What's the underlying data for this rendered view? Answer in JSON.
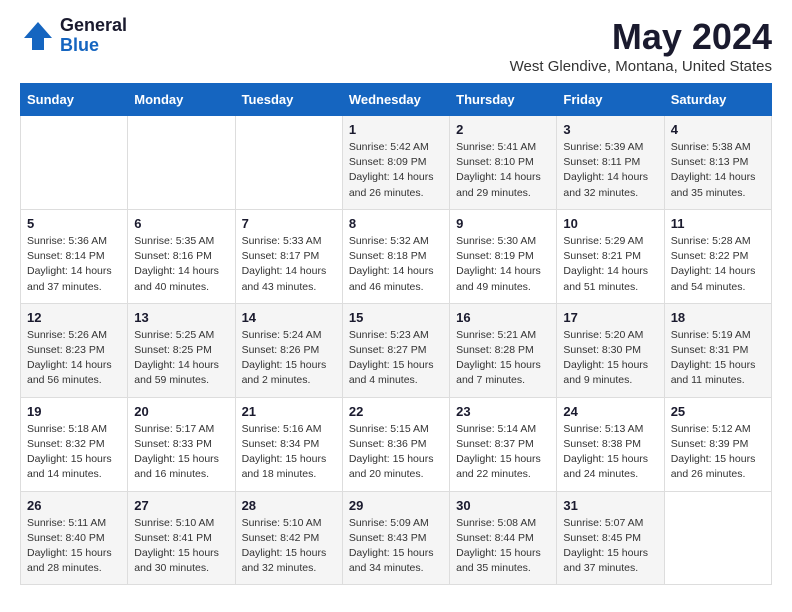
{
  "header": {
    "logo_general": "General",
    "logo_blue": "Blue",
    "title": "May 2024",
    "subtitle": "West Glendive, Montana, United States"
  },
  "weekdays": [
    "Sunday",
    "Monday",
    "Tuesday",
    "Wednesday",
    "Thursday",
    "Friday",
    "Saturday"
  ],
  "weeks": [
    [
      {
        "day": "",
        "info": ""
      },
      {
        "day": "",
        "info": ""
      },
      {
        "day": "",
        "info": ""
      },
      {
        "day": "1",
        "info": "Sunrise: 5:42 AM\nSunset: 8:09 PM\nDaylight: 14 hours\nand 26 minutes."
      },
      {
        "day": "2",
        "info": "Sunrise: 5:41 AM\nSunset: 8:10 PM\nDaylight: 14 hours\nand 29 minutes."
      },
      {
        "day": "3",
        "info": "Sunrise: 5:39 AM\nSunset: 8:11 PM\nDaylight: 14 hours\nand 32 minutes."
      },
      {
        "day": "4",
        "info": "Sunrise: 5:38 AM\nSunset: 8:13 PM\nDaylight: 14 hours\nand 35 minutes."
      }
    ],
    [
      {
        "day": "5",
        "info": "Sunrise: 5:36 AM\nSunset: 8:14 PM\nDaylight: 14 hours\nand 37 minutes."
      },
      {
        "day": "6",
        "info": "Sunrise: 5:35 AM\nSunset: 8:16 PM\nDaylight: 14 hours\nand 40 minutes."
      },
      {
        "day": "7",
        "info": "Sunrise: 5:33 AM\nSunset: 8:17 PM\nDaylight: 14 hours\nand 43 minutes."
      },
      {
        "day": "8",
        "info": "Sunrise: 5:32 AM\nSunset: 8:18 PM\nDaylight: 14 hours\nand 46 minutes."
      },
      {
        "day": "9",
        "info": "Sunrise: 5:30 AM\nSunset: 8:19 PM\nDaylight: 14 hours\nand 49 minutes."
      },
      {
        "day": "10",
        "info": "Sunrise: 5:29 AM\nSunset: 8:21 PM\nDaylight: 14 hours\nand 51 minutes."
      },
      {
        "day": "11",
        "info": "Sunrise: 5:28 AM\nSunset: 8:22 PM\nDaylight: 14 hours\nand 54 minutes."
      }
    ],
    [
      {
        "day": "12",
        "info": "Sunrise: 5:26 AM\nSunset: 8:23 PM\nDaylight: 14 hours\nand 56 minutes."
      },
      {
        "day": "13",
        "info": "Sunrise: 5:25 AM\nSunset: 8:25 PM\nDaylight: 14 hours\nand 59 minutes."
      },
      {
        "day": "14",
        "info": "Sunrise: 5:24 AM\nSunset: 8:26 PM\nDaylight: 15 hours\nand 2 minutes."
      },
      {
        "day": "15",
        "info": "Sunrise: 5:23 AM\nSunset: 8:27 PM\nDaylight: 15 hours\nand 4 minutes."
      },
      {
        "day": "16",
        "info": "Sunrise: 5:21 AM\nSunset: 8:28 PM\nDaylight: 15 hours\nand 7 minutes."
      },
      {
        "day": "17",
        "info": "Sunrise: 5:20 AM\nSunset: 8:30 PM\nDaylight: 15 hours\nand 9 minutes."
      },
      {
        "day": "18",
        "info": "Sunrise: 5:19 AM\nSunset: 8:31 PM\nDaylight: 15 hours\nand 11 minutes."
      }
    ],
    [
      {
        "day": "19",
        "info": "Sunrise: 5:18 AM\nSunset: 8:32 PM\nDaylight: 15 hours\nand 14 minutes."
      },
      {
        "day": "20",
        "info": "Sunrise: 5:17 AM\nSunset: 8:33 PM\nDaylight: 15 hours\nand 16 minutes."
      },
      {
        "day": "21",
        "info": "Sunrise: 5:16 AM\nSunset: 8:34 PM\nDaylight: 15 hours\nand 18 minutes."
      },
      {
        "day": "22",
        "info": "Sunrise: 5:15 AM\nSunset: 8:36 PM\nDaylight: 15 hours\nand 20 minutes."
      },
      {
        "day": "23",
        "info": "Sunrise: 5:14 AM\nSunset: 8:37 PM\nDaylight: 15 hours\nand 22 minutes."
      },
      {
        "day": "24",
        "info": "Sunrise: 5:13 AM\nSunset: 8:38 PM\nDaylight: 15 hours\nand 24 minutes."
      },
      {
        "day": "25",
        "info": "Sunrise: 5:12 AM\nSunset: 8:39 PM\nDaylight: 15 hours\nand 26 minutes."
      }
    ],
    [
      {
        "day": "26",
        "info": "Sunrise: 5:11 AM\nSunset: 8:40 PM\nDaylight: 15 hours\nand 28 minutes."
      },
      {
        "day": "27",
        "info": "Sunrise: 5:10 AM\nSunset: 8:41 PM\nDaylight: 15 hours\nand 30 minutes."
      },
      {
        "day": "28",
        "info": "Sunrise: 5:10 AM\nSunset: 8:42 PM\nDaylight: 15 hours\nand 32 minutes."
      },
      {
        "day": "29",
        "info": "Sunrise: 5:09 AM\nSunset: 8:43 PM\nDaylight: 15 hours\nand 34 minutes."
      },
      {
        "day": "30",
        "info": "Sunrise: 5:08 AM\nSunset: 8:44 PM\nDaylight: 15 hours\nand 35 minutes."
      },
      {
        "day": "31",
        "info": "Sunrise: 5:07 AM\nSunset: 8:45 PM\nDaylight: 15 hours\nand 37 minutes."
      },
      {
        "day": "",
        "info": ""
      }
    ]
  ]
}
